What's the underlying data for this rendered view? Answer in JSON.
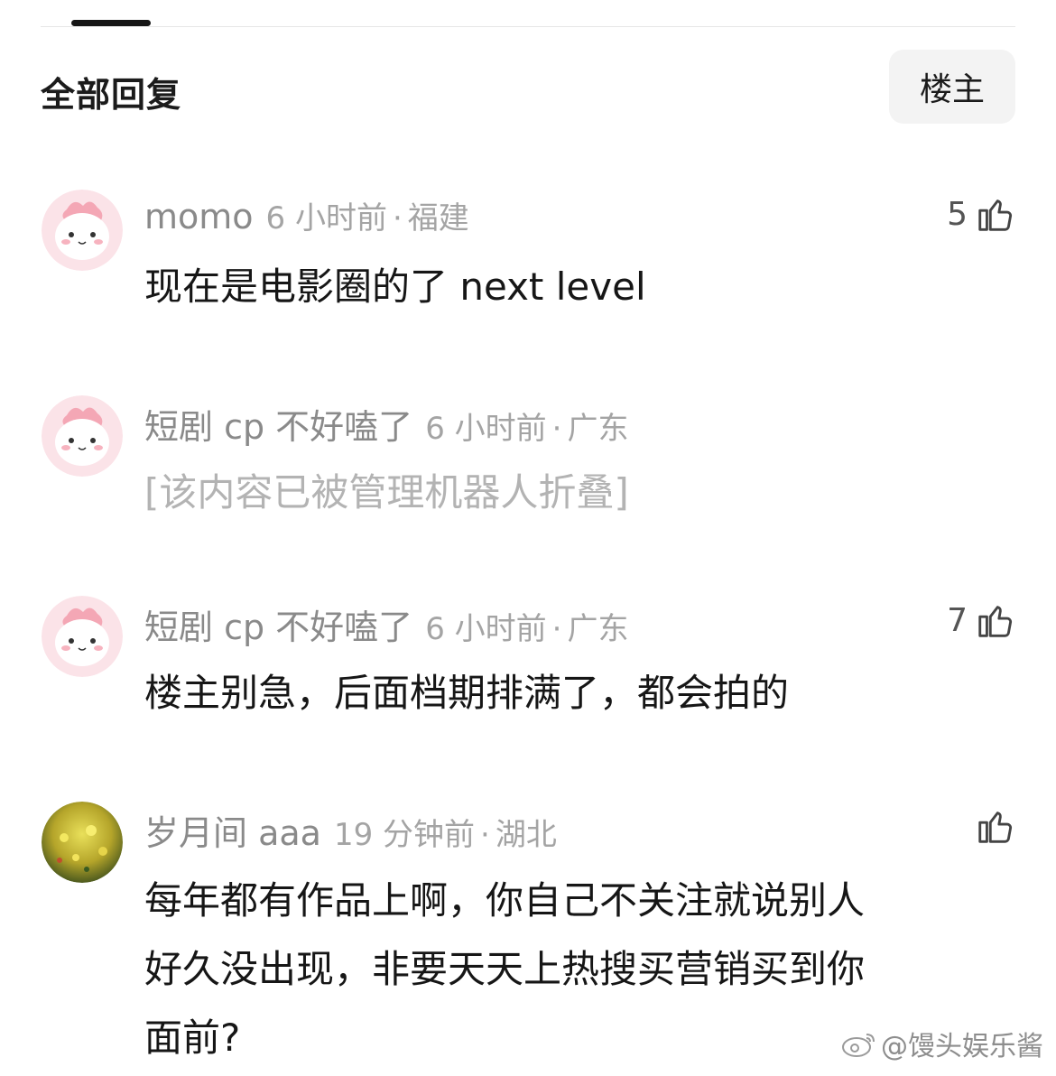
{
  "header": {
    "section_title": "全部回复",
    "op_filter_label": "楼主"
  },
  "comments": [
    {
      "username": "momo",
      "time": "6 小时前",
      "location": "福建",
      "text": "现在是电影圈的了 next level",
      "likes": "5",
      "folded": false
    },
    {
      "username": "短剧 cp 不好嗑了",
      "time": "6 小时前",
      "location": "广东",
      "text": "[该内容已被管理机器人折叠]",
      "likes": "",
      "folded": true
    },
    {
      "username": "短剧 cp 不好嗑了",
      "time": "6 小时前",
      "location": "广东",
      "text": "楼主别急，后面档期排满了，都会拍的",
      "likes": "7",
      "folded": false
    },
    {
      "username": "岁月间 aaa",
      "time": "19 分钟前",
      "location": "湖北",
      "text_lines": [
        "每年都有作品上啊，你自己不关注就说别人",
        "好久没出现，非要天天上热搜买营销买到你",
        "面前?"
      ],
      "likes": "",
      "folded": false
    }
  ],
  "watermark": {
    "text": "@馒头娱乐酱",
    "icon": "weibo-icon"
  },
  "icons": {
    "like": "thumbs-up-icon",
    "avatar_default": "pink-mascot-avatar",
    "avatar_photo": "yellow-flower-field-avatar"
  },
  "colors": {
    "meta": "#8d8d8d",
    "body": "#161616",
    "folded": "#b3b3b3",
    "chip_bg": "#f3f3f3"
  },
  "separator": "·"
}
